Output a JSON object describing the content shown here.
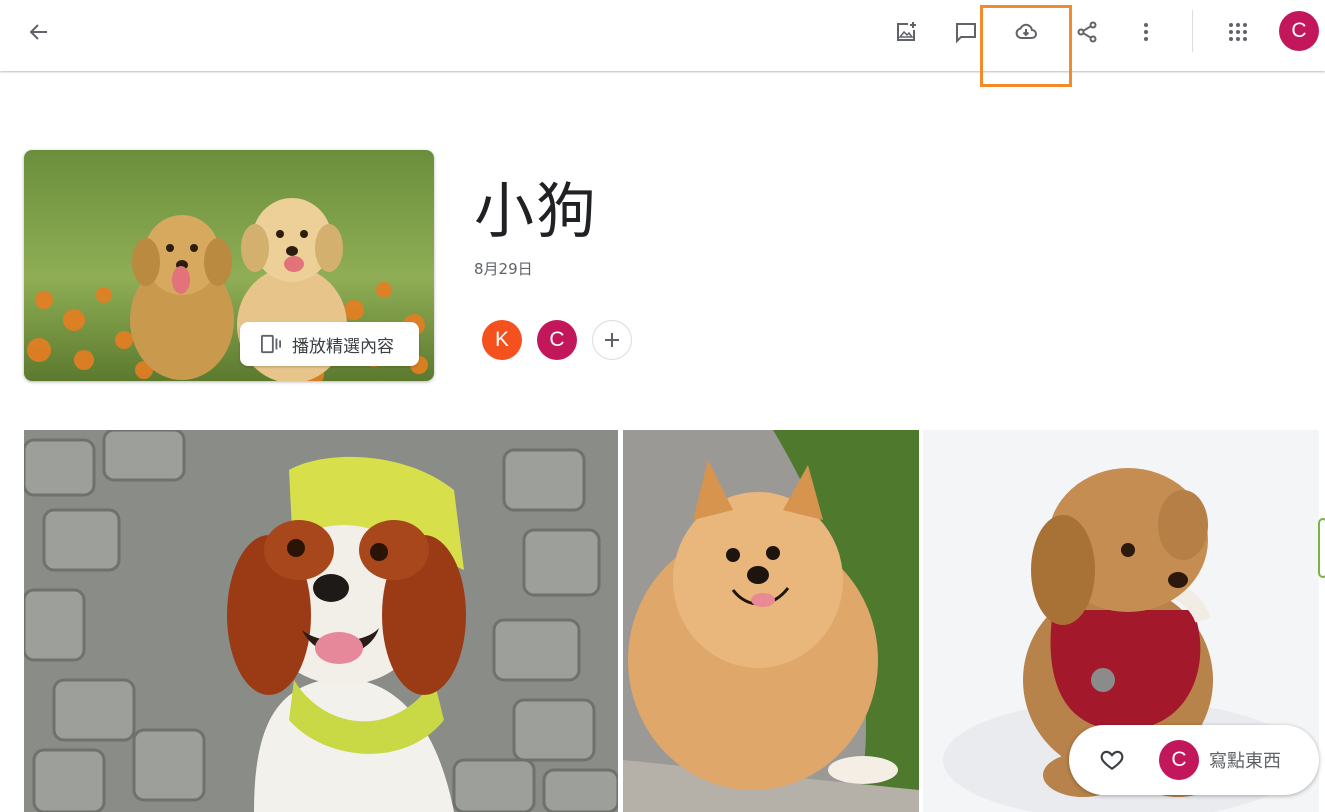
{
  "toolbar": {
    "back_icon": "arrow-back-icon",
    "add_photo_icon": "add-photo-icon",
    "comment_icon": "comment-icon",
    "download_icon": "cloud-download-icon",
    "share_icon": "share-icon",
    "more_icon": "more-vert-icon",
    "apps_icon": "apps-grid-icon",
    "account_initial": "C",
    "highlight_color": "#f28c2b"
  },
  "album": {
    "title": "小狗",
    "date": "8月29日",
    "highlights_label": "播放精選內容",
    "members": [
      {
        "initial": "K",
        "color": "#f4511e"
      },
      {
        "initial": "C",
        "color": "#c2185b"
      }
    ]
  },
  "photos": [
    {
      "subject": "cavalier-spaniel-on-cobblestones"
    },
    {
      "subject": "pomeranian-on-grass"
    },
    {
      "subject": "poodle-in-snow"
    }
  ],
  "comment_bar": {
    "heart_icon": "heart-icon",
    "avatar_initial": "C",
    "placeholder": "寫點東西"
  },
  "colors": {
    "avatar_pink": "#c2185b",
    "avatar_orange": "#f4511e",
    "icon_gray": "#5f6368"
  }
}
